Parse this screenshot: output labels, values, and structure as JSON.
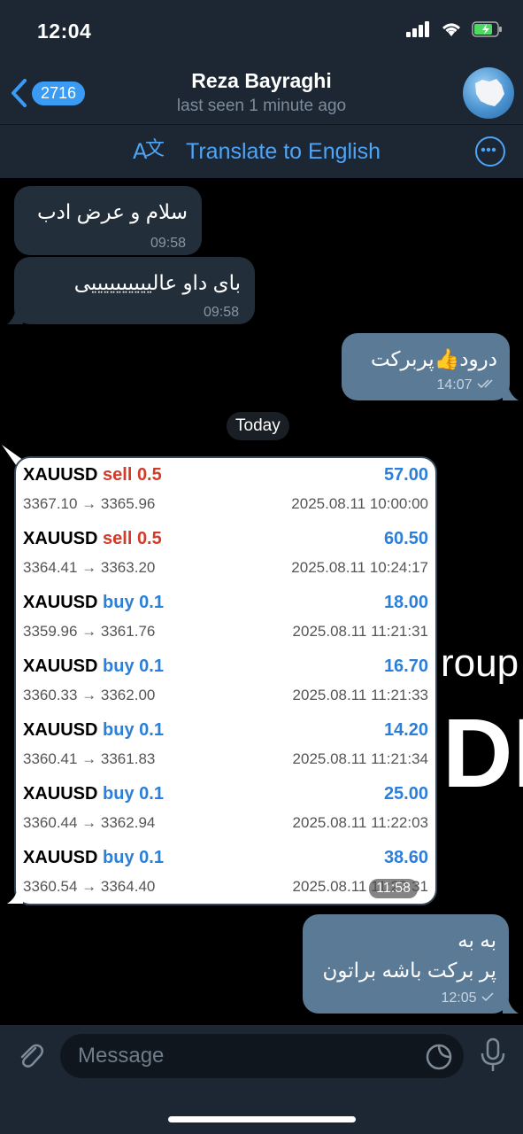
{
  "status": {
    "time": "12:04"
  },
  "header": {
    "back_count": "2716",
    "title": "Reza Bayraghi",
    "subtitle": "last seen 1 minute ago"
  },
  "translate": {
    "label": "Translate to English"
  },
  "messages": {
    "m1": {
      "text": "سلام و عرض ادب",
      "time": "09:58"
    },
    "m2": {
      "text": "بای داو عالییییییییییی",
      "time": "09:58"
    },
    "m3": {
      "text": "درود👍پربرکت",
      "time": "14:07"
    },
    "day_separator": "Today",
    "m5": {
      "line1": "به به",
      "line2": "پر برکت باشه براتون",
      "time": "12:05"
    }
  },
  "trades": [
    {
      "symbol": "XAUUSD",
      "side": "sell",
      "lot": "0.5",
      "profit": "57.00",
      "prices": "3367.10 → 3365.96",
      "date": "2025.08.11 10:00:00"
    },
    {
      "symbol": "XAUUSD",
      "side": "sell",
      "lot": "0.5",
      "profit": "60.50",
      "prices": "3364.41 → 3363.20",
      "date": "2025.08.11 10:24:17"
    },
    {
      "symbol": "XAUUSD",
      "side": "buy",
      "lot": "0.1",
      "profit": "18.00",
      "prices": "3359.96 → 3361.76",
      "date": "2025.08.11 11:21:31"
    },
    {
      "symbol": "XAUUSD",
      "side": "buy",
      "lot": "0.1",
      "profit": "16.70",
      "prices": "3360.33 → 3362.00",
      "date": "2025.08.11 11:21:33"
    },
    {
      "symbol": "XAUUSD",
      "side": "buy",
      "lot": "0.1",
      "profit": "14.20",
      "prices": "3360.41 → 3361.83",
      "date": "2025.08.11 11:21:34"
    },
    {
      "symbol": "XAUUSD",
      "side": "buy",
      "lot": "0.1",
      "profit": "25.00",
      "prices": "3360.44 → 3362.94",
      "date": "2025.08.11 11:22:03"
    },
    {
      "symbol": "XAUUSD",
      "side": "buy",
      "lot": "0.1",
      "profit": "38.60",
      "prices": "3360.54 → 3364.40",
      "date": "2025.08.11 11:22:31"
    }
  ],
  "trade_card_time": "11:58",
  "background": {
    "logo_text": "DI",
    "logo_sub": "roup"
  },
  "input": {
    "placeholder": "Message"
  },
  "colors": {
    "sell": "#d23a2a",
    "buy": "#2b7fd9",
    "accent": "#4ea4f6"
  }
}
